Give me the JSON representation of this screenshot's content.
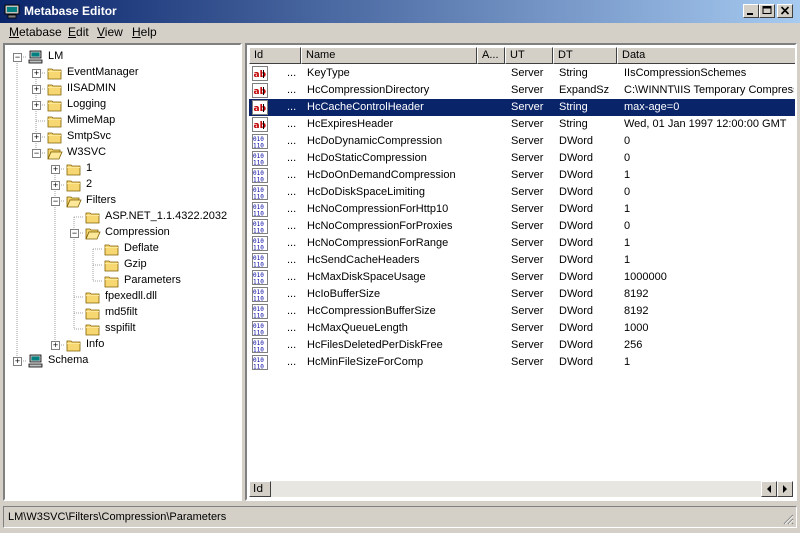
{
  "window": {
    "title": "Metabase Editor"
  },
  "menu": [
    {
      "label": "Metabase",
      "underline": "M",
      "rest": "etabase"
    },
    {
      "label": "Edit",
      "underline": "E",
      "rest": "dit"
    },
    {
      "label": "View",
      "underline": "V",
      "rest": "iew"
    },
    {
      "label": "Help",
      "underline": "H",
      "rest": "elp"
    }
  ],
  "tree": [
    {
      "label": "LM",
      "expander": "-",
      "icon": "computer-icon"
    },
    {
      "label": "EventManager",
      "expander": "+",
      "icon": "folder-icon"
    },
    {
      "label": "IISADMIN",
      "expander": "+",
      "icon": "folder-icon"
    },
    {
      "label": "Logging",
      "expander": "+",
      "icon": "folder-icon"
    },
    {
      "label": "MimeMap",
      "expander": "",
      "icon": "folder-icon"
    },
    {
      "label": "SmtpSvc",
      "expander": "+",
      "icon": "folder-icon"
    },
    {
      "label": "W3SVC",
      "expander": "-",
      "icon": "folder-icon"
    },
    {
      "label": "1",
      "expander": "+",
      "icon": "folder-icon"
    },
    {
      "label": "2",
      "expander": "+",
      "icon": "folder-icon"
    },
    {
      "label": "Filters",
      "expander": "-",
      "icon": "folder-icon"
    },
    {
      "label": "ASP.NET_1.1.4322.2032",
      "expander": "",
      "icon": "folder-icon"
    },
    {
      "label": "Compression",
      "expander": "-",
      "icon": "folder-icon"
    },
    {
      "label": "Deflate",
      "expander": "",
      "icon": "folder-icon"
    },
    {
      "label": "Gzip",
      "expander": "",
      "icon": "folder-icon"
    },
    {
      "label": "Parameters",
      "expander": "",
      "icon": "folder-icon"
    },
    {
      "label": "fpexedll.dll",
      "expander": "",
      "icon": "folder-icon"
    },
    {
      "label": "md5filt",
      "expander": "",
      "icon": "folder-icon"
    },
    {
      "label": "sspifilt",
      "expander": "",
      "icon": "folder-icon"
    },
    {
      "label": "Info",
      "expander": "+",
      "icon": "folder-icon"
    },
    {
      "label": "Schema",
      "expander": "+",
      "icon": "computer-icon"
    }
  ],
  "list": {
    "columns": [
      "Id",
      "Name",
      "A...",
      "UT",
      "DT",
      "Data"
    ],
    "rows": [
      {
        "icon": "string-icon",
        "id": "...",
        "name": "KeyType",
        "ut": "Server",
        "dt": "String",
        "data": "IIsCompressionSchemes"
      },
      {
        "icon": "string-icon",
        "id": "...",
        "name": "HcCompressionDirectory",
        "ut": "Server",
        "dt": "ExpandSz",
        "data": "C:\\WINNT\\IIS Temporary Compressed Files"
      },
      {
        "icon": "string-icon",
        "id": "...",
        "name": "HcCacheControlHeader",
        "ut": "Server",
        "dt": "String",
        "data": "max-age=0",
        "selected": true
      },
      {
        "icon": "string-icon",
        "id": "...",
        "name": "HcExpiresHeader",
        "ut": "Server",
        "dt": "String",
        "data": "Wed, 01 Jan 1997 12:00:00 GMT"
      },
      {
        "icon": "dword-icon",
        "id": "...",
        "name": "HcDoDynamicCompression",
        "ut": "Server",
        "dt": "DWord",
        "data": "0"
      },
      {
        "icon": "dword-icon",
        "id": "...",
        "name": "HcDoStaticCompression",
        "ut": "Server",
        "dt": "DWord",
        "data": "0"
      },
      {
        "icon": "dword-icon",
        "id": "...",
        "name": "HcDoOnDemandCompression",
        "ut": "Server",
        "dt": "DWord",
        "data": "1"
      },
      {
        "icon": "dword-icon",
        "id": "...",
        "name": "HcDoDiskSpaceLimiting",
        "ut": "Server",
        "dt": "DWord",
        "data": "0"
      },
      {
        "icon": "dword-icon",
        "id": "...",
        "name": "HcNoCompressionForHttp10",
        "ut": "Server",
        "dt": "DWord",
        "data": "1"
      },
      {
        "icon": "dword-icon",
        "id": "...",
        "name": "HcNoCompressionForProxies",
        "ut": "Server",
        "dt": "DWord",
        "data": "0"
      },
      {
        "icon": "dword-icon",
        "id": "...",
        "name": "HcNoCompressionForRange",
        "ut": "Server",
        "dt": "DWord",
        "data": "1"
      },
      {
        "icon": "dword-icon",
        "id": "...",
        "name": "HcSendCacheHeaders",
        "ut": "Server",
        "dt": "DWord",
        "data": "1"
      },
      {
        "icon": "dword-icon",
        "id": "...",
        "name": "HcMaxDiskSpaceUsage",
        "ut": "Server",
        "dt": "DWord",
        "data": "1000000"
      },
      {
        "icon": "dword-icon",
        "id": "...",
        "name": "HcIoBufferSize",
        "ut": "Server",
        "dt": "DWord",
        "data": "8192"
      },
      {
        "icon": "dword-icon",
        "id": "...",
        "name": "HcCompressionBufferSize",
        "ut": "Server",
        "dt": "DWord",
        "data": "8192"
      },
      {
        "icon": "dword-icon",
        "id": "...",
        "name": "HcMaxQueueLength",
        "ut": "Server",
        "dt": "DWord",
        "data": "1000"
      },
      {
        "icon": "dword-icon",
        "id": "...",
        "name": "HcFilesDeletedPerDiskFree",
        "ut": "Server",
        "dt": "DWord",
        "data": "256"
      },
      {
        "icon": "dword-icon",
        "id": "...",
        "name": "HcMinFileSizeForComp",
        "ut": "Server",
        "dt": "DWord",
        "data": "1"
      }
    ],
    "scroll_header": "Id"
  },
  "status": {
    "path": "LM\\W3SVC\\Filters\\Compression\\Parameters"
  },
  "colors": {
    "titlebar": "#0a246a",
    "selection": "#0a246a",
    "face": "#d4d0c8",
    "folder": "#f7d772"
  }
}
